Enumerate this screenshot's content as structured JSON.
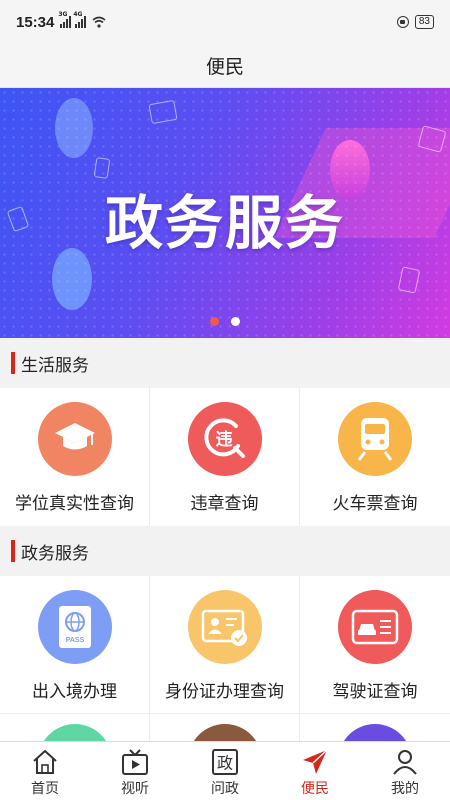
{
  "status_bar": {
    "time": "15:34",
    "network_1": "3G",
    "network_2": "4G",
    "battery": "83"
  },
  "header": {
    "title": "便民"
  },
  "banner": {
    "title": "政务服务",
    "slide_count": 2,
    "active_slide": 1
  },
  "sections": [
    {
      "title": "生活服务",
      "items": [
        {
          "label": "学位真实性查询",
          "icon": "graduation-cap-icon",
          "color": "#f08463"
        },
        {
          "label": "违章查询",
          "icon": "traffic-violation-icon",
          "color": "#ef5a5a"
        },
        {
          "label": "火车票查询",
          "icon": "train-icon",
          "color": "#f8b64a"
        }
      ]
    },
    {
      "title": "政务服务",
      "items": [
        {
          "label": "出入境办理",
          "icon": "passport-icon",
          "color": "#7e9ef5"
        },
        {
          "label": "身份证办理查询",
          "icon": "id-card-icon",
          "color": "#f9c56b"
        },
        {
          "label": "驾驶证查询",
          "icon": "driver-license-icon",
          "color": "#f05a5a"
        }
      ]
    }
  ],
  "partial_row_colors": [
    "#5fd6a4",
    "#8a5a3f",
    "#6a4de0"
  ],
  "tab_bar": {
    "tabs": [
      {
        "label": "首页",
        "icon": "home-icon"
      },
      {
        "label": "视听",
        "icon": "tv-icon"
      },
      {
        "label": "问政",
        "icon": "politics-icon",
        "icon_text": "政"
      },
      {
        "label": "便民",
        "icon": "send-icon",
        "active": true
      },
      {
        "label": "我的",
        "icon": "profile-icon"
      }
    ]
  },
  "colors": {
    "accent": "#d8261b"
  }
}
